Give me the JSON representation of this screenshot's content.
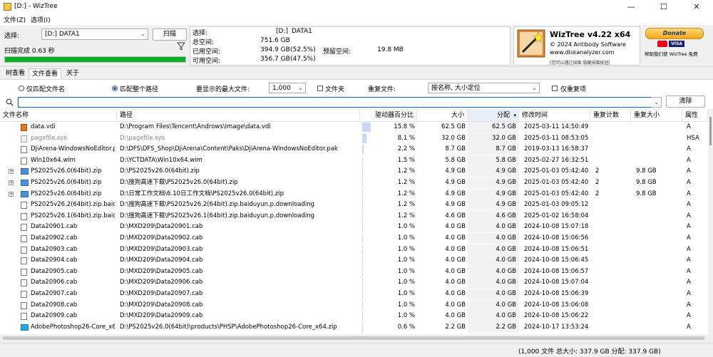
{
  "window": {
    "title": "[D:]  - WizTree",
    "minimize_glyph": "—",
    "maximize_glyph": "☐",
    "close_glyph": "✕"
  },
  "menu": [
    "文件(Z)",
    "选项(I)"
  ],
  "scan": {
    "select_label": "选择:",
    "drive_value": "[D:] DATA1",
    "scan_button": "扫描",
    "status": "扫描完成 0.63 秒",
    "filter_icon": "filter-icon",
    "progress": 1.0
  },
  "drive_info": {
    "select_label": "选择:",
    "select_value": "[D:]",
    "select_name": "DATA1",
    "total_label": "总空间:",
    "total_value": "751.6 GB",
    "used_label": "已用空间:",
    "used_value": "394.9 GB",
    "used_pct": "(52.5%)",
    "reserved_label": "预留空间:",
    "reserved_value": "19.8 MB",
    "free_label": "可用空间:",
    "free_value": "356.7 GB",
    "free_pct": "(47.5%)"
  },
  "logo": {
    "title": "WizTree v4.22 x64",
    "copyright": "© 2024 Antibody Software",
    "url": "www.diskanalyzer.com",
    "note": "(您可以通过捐赠 隐藏捐赠按钮)"
  },
  "donate": {
    "button": "Donate",
    "caption": "帮助我们使 WizTree 免费",
    "visa": "VISA"
  },
  "tabs": [
    "树查看",
    "文件查看",
    "关于"
  ],
  "options": {
    "match_filename": "仅匹配文件名",
    "match_fullpath": "匹配整个路径",
    "max_files_label": "要显示的最大文件:",
    "max_files_value": "1,000",
    "folders_label": "文件夹",
    "dup_label": "重复文件:",
    "dup_value": "按名称, 大小定位",
    "dup_only_label": "仅重复项"
  },
  "search": {
    "placeholder": "",
    "clear_button": "清除"
  },
  "columns": [
    "文件名称",
    "路径",
    "驱动器百分比",
    "大小",
    "分配",
    "修改时间",
    "重复计数",
    "重复大小",
    "属性"
  ],
  "rows": [
    {
      "name": "data.vdi",
      "icon": "vdi",
      "expand": false,
      "gray": false,
      "path": "D:\\Program Files\\Tencent\\Androws\\Image\\data.vdi",
      "pct": "15.8 %",
      "pctv": 15.8,
      "size": "62.5 GB",
      "alloc": "62.5 GB",
      "mtime": "2025-03-11 14:50:49",
      "dupc": "",
      "dups": "",
      "attr": "A"
    },
    {
      "name": "pagefile.sys",
      "icon": "sys",
      "expand": false,
      "gray": true,
      "path": "D:\\pagefile.sys",
      "pct": "8.1 %",
      "pctv": 8.1,
      "size": "32.0 GB",
      "alloc": "32.0 GB",
      "mtime": "2025-03-11 08:53:05",
      "dupc": "",
      "dups": "",
      "attr": "HSA"
    },
    {
      "name": "DjiArena-WindowsNoEditor.pak",
      "icon": "doc",
      "expand": false,
      "gray": false,
      "path": "D:\\DFS\\DFS_Shop\\DjiArena\\Content\\Paks\\DjiArena-WindowsNoEditor.pak",
      "pct": "2.2 %",
      "pctv": 2.2,
      "size": "8.7 GB",
      "alloc": "8.7 GB",
      "mtime": "2019-03-13 16:58:37",
      "dupc": "",
      "dups": "",
      "attr": "A"
    },
    {
      "name": "Win10x64.wim",
      "icon": "doc",
      "expand": false,
      "gray": false,
      "path": "D:\\YCTDATA\\Win10x64.wim",
      "pct": "1.5 %",
      "pctv": 1.5,
      "size": "5.8 GB",
      "alloc": "5.8 GB",
      "mtime": "2025-02-27 16:32:51",
      "dupc": "",
      "dups": "",
      "attr": "A"
    },
    {
      "name": "PS2025v26.0(64bit).zip",
      "icon": "zip",
      "expand": true,
      "gray": false,
      "path": "D:\\PS2025v26.0(64bit).zip",
      "pct": "1.2 %",
      "pctv": 1.2,
      "size": "4.9 GB",
      "alloc": "4.9 GB",
      "mtime": "2025-01-03 05:42:40",
      "dupc": "2",
      "dups": "9.8 GB",
      "attr": "A"
    },
    {
      "name": "PS2025v26.0(64bit).zip",
      "icon": "zip",
      "expand": true,
      "gray": false,
      "path": "D:\\搜狗高速下载\\PS2025v26.0(64bit).zip",
      "pct": "1.2 %",
      "pctv": 1.2,
      "size": "4.9 GB",
      "alloc": "4.9 GB",
      "mtime": "2025-01-03 05:42:40",
      "dupc": "2",
      "dups": "9.8 GB",
      "attr": "A"
    },
    {
      "name": "PS2025v26.0(64bit).zip",
      "icon": "zip",
      "expand": true,
      "gray": false,
      "path": "D:\\日常工作文档\\6.10日工作文档\\PS2025v26.0(64bit).zip",
      "pct": "1.2 %",
      "pctv": 1.2,
      "size": "4.9 GB",
      "alloc": "4.9 GB",
      "mtime": "2025-01-03 05:42:40",
      "dupc": "2",
      "dups": "9.8 GB",
      "attr": "A"
    },
    {
      "name": "PS2025v26.2(64bit).zip.baiduyun",
      "icon": "doc",
      "expand": false,
      "gray": false,
      "path": "D:\\搜狗高速下载\\PS2025v26.2(64bit).zip.baiduyun.p.downloading",
      "pct": "1.2 %",
      "pctv": 1.2,
      "size": "4.9 GB",
      "alloc": "4.9 GB",
      "mtime": "2025-01-03 09:05:12",
      "dupc": "",
      "dups": "",
      "attr": "A"
    },
    {
      "name": "PS2025v26.1(64bit).zip.baiduyun",
      "icon": "doc",
      "expand": false,
      "gray": false,
      "path": "D:\\搜狗高速下载\\PS2025v26.1(64bit).zip.baiduyun.p.downloading",
      "pct": "1.2 %",
      "pctv": 1.2,
      "size": "4.6 GB",
      "alloc": "4.6 GB",
      "mtime": "2025-01-02 16:58:04",
      "dupc": "",
      "dups": "",
      "attr": "A"
    },
    {
      "name": "Data20901.cab",
      "icon": "doc",
      "expand": false,
      "gray": false,
      "path": "D:\\MXD209\\Data20901.cab",
      "pct": "1.0 %",
      "pctv": 1.0,
      "size": "4.0 GB",
      "alloc": "4.0 GB",
      "mtime": "2024-10-08 15:07:18",
      "dupc": "",
      "dups": "",
      "attr": "A"
    },
    {
      "name": "Data20902.cab",
      "icon": "doc",
      "expand": false,
      "gray": false,
      "path": "D:\\MXD209\\Data20902.cab",
      "pct": "1.0 %",
      "pctv": 1.0,
      "size": "4.0 GB",
      "alloc": "4.0 GB",
      "mtime": "2024-10-08 15:06:56",
      "dupc": "",
      "dups": "",
      "attr": "A"
    },
    {
      "name": "Data20903.cab",
      "icon": "doc",
      "expand": false,
      "gray": false,
      "path": "D:\\MXD209\\Data20903.cab",
      "pct": "1.0 %",
      "pctv": 1.0,
      "size": "4.0 GB",
      "alloc": "4.0 GB",
      "mtime": "2024-10-08 15:06:51",
      "dupc": "",
      "dups": "",
      "attr": "A"
    },
    {
      "name": "Data20904.cab",
      "icon": "doc",
      "expand": false,
      "gray": false,
      "path": "D:\\MXD209\\Data20904.cab",
      "pct": "1.0 %",
      "pctv": 1.0,
      "size": "4.0 GB",
      "alloc": "4.0 GB",
      "mtime": "2024-10-08 15:06:45",
      "dupc": "",
      "dups": "",
      "attr": "A"
    },
    {
      "name": "Data20905.cab",
      "icon": "doc",
      "expand": false,
      "gray": false,
      "path": "D:\\MXD209\\Data20905.cab",
      "pct": "1.0 %",
      "pctv": 1.0,
      "size": "4.0 GB",
      "alloc": "4.0 GB",
      "mtime": "2024-10-08 15:06:57",
      "dupc": "",
      "dups": "",
      "attr": "A"
    },
    {
      "name": "Data20906.cab",
      "icon": "doc",
      "expand": false,
      "gray": false,
      "path": "D:\\MXD209\\Data20906.cab",
      "pct": "1.0 %",
      "pctv": 1.0,
      "size": "4.0 GB",
      "alloc": "4.0 GB",
      "mtime": "2024-10-08 15:07:04",
      "dupc": "",
      "dups": "",
      "attr": "A"
    },
    {
      "name": "Data20907.cab",
      "icon": "doc",
      "expand": false,
      "gray": false,
      "path": "D:\\MXD209\\Data20907.cab",
      "pct": "1.0 %",
      "pctv": 1.0,
      "size": "4.0 GB",
      "alloc": "4.0 GB",
      "mtime": "2024-10-08 15:06:39",
      "dupc": "",
      "dups": "",
      "attr": "A"
    },
    {
      "name": "Data20908.cab",
      "icon": "doc",
      "expand": false,
      "gray": false,
      "path": "D:\\MXD209\\Data20908.cab",
      "pct": "1.0 %",
      "pctv": 1.0,
      "size": "4.0 GB",
      "alloc": "4.0 GB",
      "mtime": "2024-10-08 15:06:08",
      "dupc": "",
      "dups": "",
      "attr": "A"
    },
    {
      "name": "Data20909.cab",
      "icon": "doc",
      "expand": false,
      "gray": false,
      "path": "D:\\MXD209\\Data20909.cab",
      "pct": "1.0 %",
      "pctv": 1.0,
      "size": "4.0 GB",
      "alloc": "4.0 GB",
      "mtime": "2024-10-08 15:06:22",
      "dupc": "",
      "dups": "",
      "attr": "A"
    },
    {
      "name": "AdobePhotoshop26-Core_x64.z",
      "icon": "app",
      "expand": false,
      "gray": false,
      "path": "D:\\PS2025v26.0(64bit)\\products\\PHSP\\AdobePhotoshop26-Core_x64.zip",
      "pct": "0.6 %",
      "pctv": 0.6,
      "size": "2.2 GB",
      "alloc": "2.2 GB",
      "mtime": "2024-10-17 13:53:24",
      "dupc": "",
      "dups": "",
      "attr": "A"
    }
  ],
  "status": "(1,000 文件 总大小: 337.9 GB  分配: 337.9 GB)",
  "colors": {
    "accent": "#0060c0",
    "pct_bar": "#c7d9f3",
    "progress": "#06b025"
  }
}
